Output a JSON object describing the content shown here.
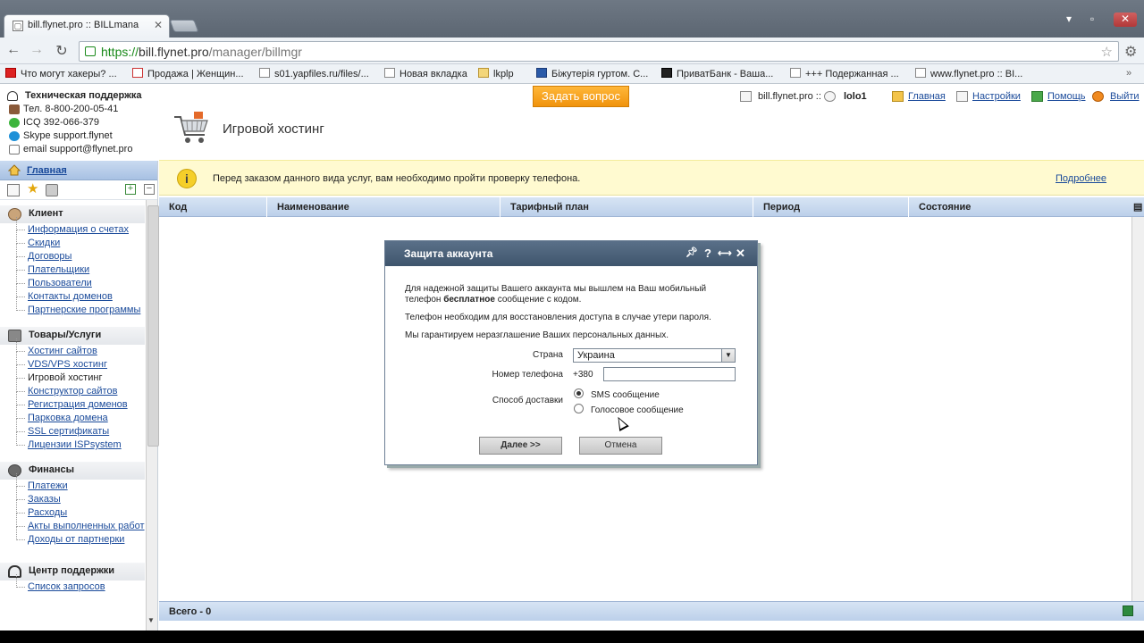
{
  "browser": {
    "tab_title": "bill.flynet.pro :: BILLmana",
    "url_scheme": "https://",
    "url_host": "bill.flynet.pro",
    "url_path": "/manager/billmgr",
    "bookmarks": [
      "Что могут хакеры? ...",
      "Продажа | Женщин...",
      "s01.yapfiles.ru/files/...",
      "Новая вкладка",
      "lkplp",
      "Біжутерія гуртом. С...",
      "ПриватБанк - Ваша...",
      "+++ Подержанная ...",
      "www.flynet.pro :: BI..."
    ]
  },
  "support": {
    "title": "Техническая поддержка",
    "phone": "Тел. 8-800-200-05-41",
    "icq": "ICQ 392-066-379",
    "skype": "Skype support.flynet",
    "email": "email support@flynet.pro"
  },
  "ask_button": "Задать вопрос",
  "topnav": {
    "site": "bill.flynet.pro ::",
    "user": "lolo1",
    "home": "Главная",
    "settings": "Настройки",
    "help": "Помощь",
    "logout": "Выйти"
  },
  "section_title": "Игровой хостинг",
  "sidebar": {
    "main": "Главная",
    "groups": [
      {
        "title": "Клиент",
        "items": [
          "Информация о счетах",
          "Скидки",
          "Договоры",
          "Плательщики",
          "Пользователи",
          "Контакты доменов",
          "Партнерские программы"
        ]
      },
      {
        "title": "Товары/Услуги",
        "items": [
          "Хостинг сайтов",
          "VDS/VPS хостинг",
          "Игровой хостинг",
          "Конструктор сайтов",
          "Регистрация доменов",
          "Парковка домена",
          "SSL сертификаты",
          "Лицензии ISPsystem"
        ]
      },
      {
        "title": "Финансы",
        "items": [
          "Платежи",
          "Заказы",
          "Расходы",
          "Акты выполненных работ",
          "Доходы от партнерки"
        ]
      },
      {
        "title": "Центр поддержки",
        "items": [
          "Список запросов"
        ]
      }
    ]
  },
  "notice": {
    "text": "Перед заказом данного вида услуг, вам необходимо пройти проверку телефона.",
    "link": "Подробнее"
  },
  "table": {
    "columns": [
      "Код",
      "Наименование",
      "Тарифный план",
      "Период",
      "Состояние"
    ],
    "footer": "Всего - 0"
  },
  "dialog": {
    "title": "Защита аккаунта",
    "p1_a": "Для надежной защиты Вашего аккаунта мы вышлем на Ваш мобильный телефон ",
    "p1_bold": "бесплатное",
    "p1_b": " сообщение с кодом.",
    "p2": "Телефон необходим для восстановления доступа в случае утери пароля.",
    "p3": "Мы гарантируем неразглашение Ваших персональных данных.",
    "country_label": "Страна",
    "country_value": "Украина",
    "phone_label": "Номер телефона",
    "phone_prefix": "+380",
    "phone_value": "",
    "delivery_label": "Способ доставки",
    "delivery_options": [
      "SMS сообщение",
      "Голосовое сообщение"
    ],
    "next_button": "Далее >>",
    "cancel_button": "Отмена"
  }
}
